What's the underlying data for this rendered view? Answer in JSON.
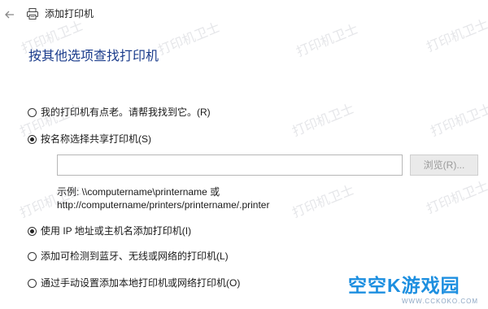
{
  "window": {
    "title": "添加打印机",
    "back_icon": "arrow-left-icon",
    "printer_icon": "printer-icon"
  },
  "heading": "按其他选项查找打印机",
  "options": [
    {
      "label": "我的打印机有点老。请帮我找到它。(R)",
      "checked": false
    },
    {
      "label": "按名称选择共享打印机(S)",
      "checked": true
    },
    {
      "label": "使用 IP 地址或主机名添加打印机(I)",
      "checked": true
    },
    {
      "label": "添加可检测到蓝牙、无线或网络的打印机(L)",
      "checked": false
    },
    {
      "label": "通过手动设置添加本地打印机或网络打印机(O)",
      "checked": false
    }
  ],
  "share": {
    "input_value": "",
    "browse_label": "浏览(R)...",
    "example_line1": "示例: \\\\computername\\printername 或",
    "example_line2": "http://computername/printers/printername/.printer"
  },
  "watermark": {
    "text": "打印机卫士",
    "brand": "空空K游戏园",
    "url": "WWW.CCKOKO.COM"
  },
  "colors": {
    "heading": "#1b3c8c",
    "brand": "#1d8fe0"
  }
}
